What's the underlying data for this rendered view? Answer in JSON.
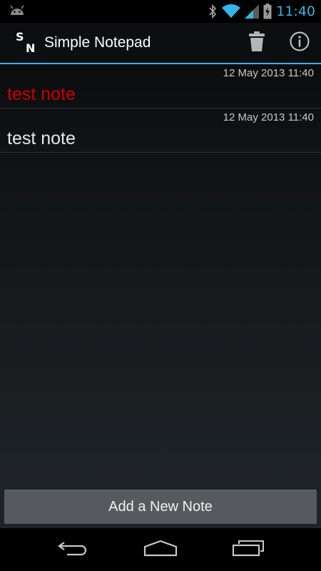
{
  "status_bar": {
    "time": "11:40",
    "icons": [
      "android-icon",
      "bluetooth-icon",
      "wifi-icon",
      "signal-icon",
      "battery-charging-icon"
    ],
    "accent_color": "#33b5e5"
  },
  "action_bar": {
    "app_icon_letters": {
      "top": "S",
      "bottom": "N"
    },
    "title": "Simple Notepad",
    "actions": [
      "trash-icon",
      "info-icon"
    ],
    "accent_color": "#33b5e5"
  },
  "notes": [
    {
      "date": "12 May 2013 11:40",
      "title": "test note",
      "title_color": "#cc0000"
    },
    {
      "date": "12 May 2013 11:40",
      "title": "test note",
      "title_color": "#e8e8e8"
    }
  ],
  "add_button": {
    "label": "Add a New Note"
  },
  "nav_bar": {
    "buttons": [
      "back-icon",
      "home-icon",
      "recent-apps-icon"
    ]
  }
}
